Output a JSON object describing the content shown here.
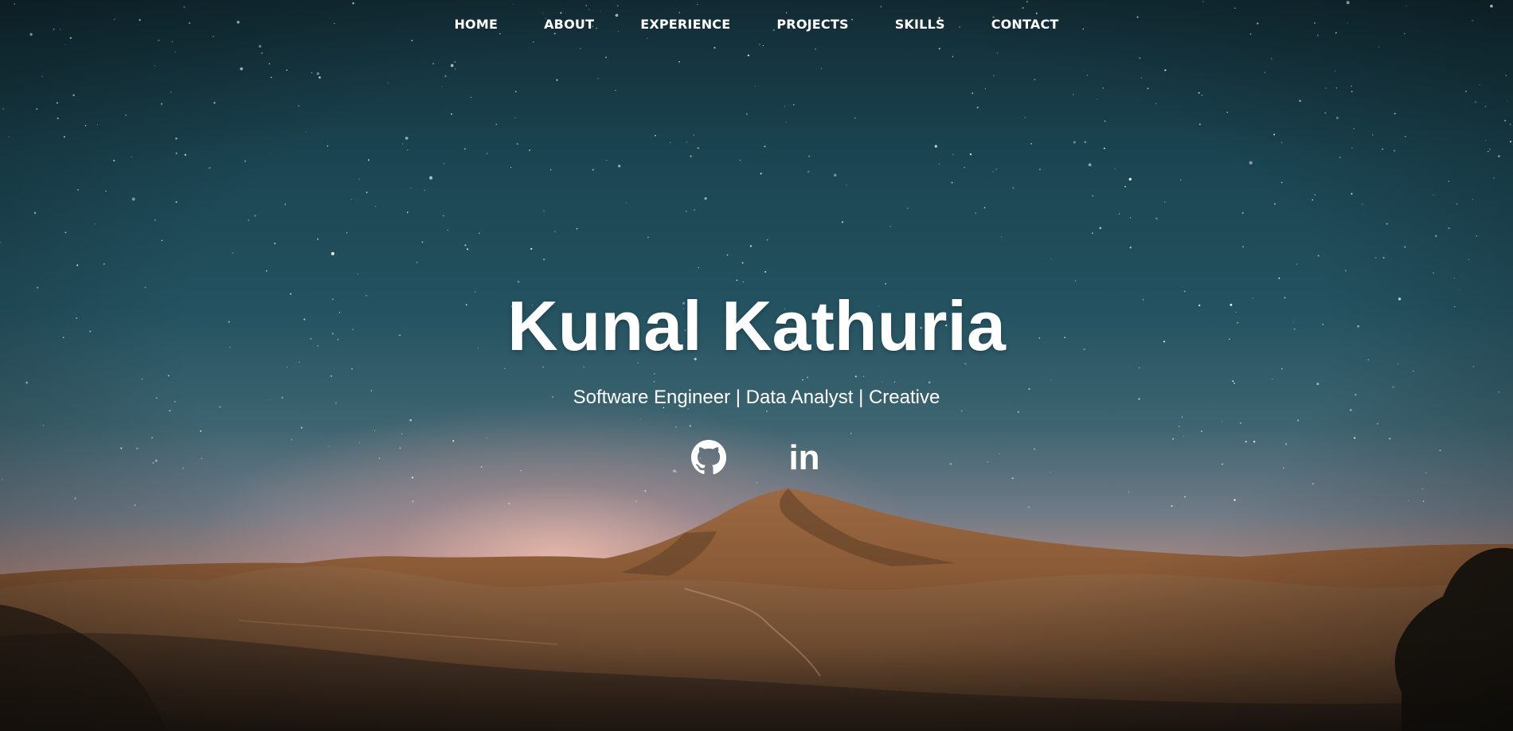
{
  "nav": {
    "items": [
      {
        "label": "HOME"
      },
      {
        "label": "ABOUT"
      },
      {
        "label": "EXPERIENCE"
      },
      {
        "label": "PROJECTS"
      },
      {
        "label": "SKILLS"
      },
      {
        "label": "CONTACT"
      }
    ]
  },
  "hero": {
    "name": "Kunal Kathuria",
    "tagline": "Software Engineer | Data Analyst | Creative",
    "background": "night sky with stars over desert mountains"
  },
  "socials": {
    "github_icon": "github-icon",
    "linkedin_icon": "linkedin-icon",
    "linkedin_glyph": "in"
  },
  "colors": {
    "text": "#ffffff",
    "sky_top": "#122b34",
    "sky_mid": "#245260",
    "horizon_glow": "#d9a493",
    "land": "#8a5a36"
  }
}
